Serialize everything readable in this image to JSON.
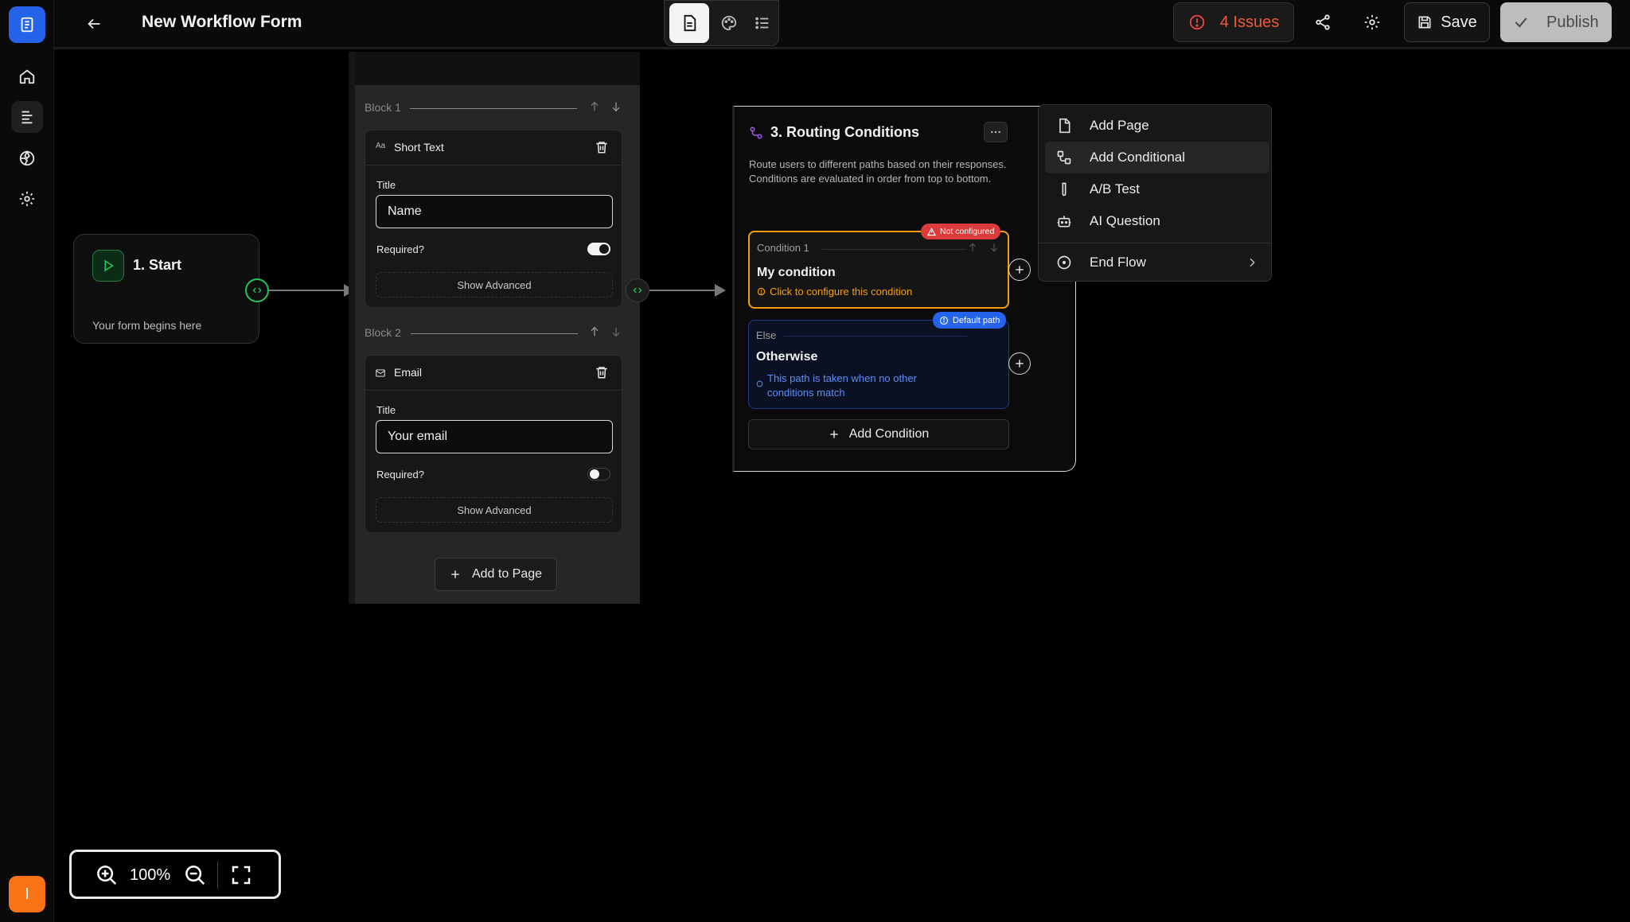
{
  "header": {
    "title": "New Workflow Form",
    "issues_label": "4 Issues",
    "save_label": "Save",
    "publish_label": "Publish",
    "view_tabs": [
      "document-icon",
      "palette-icon",
      "list-icon"
    ]
  },
  "sidebar": {
    "items": [
      "app-logo-icon",
      "home-icon",
      "forms-icon",
      "integrations-icon",
      "settings-icon"
    ],
    "user_avatar": "I"
  },
  "start_node": {
    "title": "1. Start",
    "subtitle": "Your form begins here"
  },
  "page_node": {
    "blocks": [
      {
        "label": "Block 1",
        "type_label": "Short Text",
        "type_icon": "Aa",
        "title_label": "Title",
        "title_value": "Name",
        "required_label": "Required?",
        "required": true,
        "advanced_label": "Show Advanced"
      },
      {
        "label": "Block 2",
        "type_label": "Email",
        "title_label": "Title",
        "title_value": "Your email",
        "required_label": "Required?",
        "required": false,
        "advanced_label": "Show Advanced"
      }
    ],
    "add_button_label": "Add to Page"
  },
  "routing_node": {
    "title": "3. Routing Conditions",
    "description": "Route users to different paths based on their responses. Conditions are evaluated in order from top to bottom.",
    "condition": {
      "label": "Condition 1",
      "badge": "Not configured",
      "name": "My condition",
      "hint": "Click to configure this condition"
    },
    "else_path": {
      "label": "Else",
      "badge": "Default path",
      "name": "Otherwise",
      "hint": "This path is taken when no other conditions match"
    },
    "add_condition_label": "Add Condition"
  },
  "add_menu": {
    "items": [
      {
        "label": "Add Page",
        "icon": "page-icon"
      },
      {
        "label": "Add Conditional",
        "icon": "conditional-icon"
      },
      {
        "label": "A/B Test",
        "icon": "flask-icon"
      },
      {
        "label": "AI Question",
        "icon": "robot-icon"
      },
      {
        "label": "End Flow",
        "icon": "end-circle-icon"
      }
    ]
  },
  "zoom": {
    "level": "100%"
  },
  "colors": {
    "accent_blue": "#2563eb",
    "warning_orange": "#f59e0b",
    "issue_red": "#ef4444",
    "success_green": "#22c55e",
    "avatar_orange": "#f97316"
  }
}
